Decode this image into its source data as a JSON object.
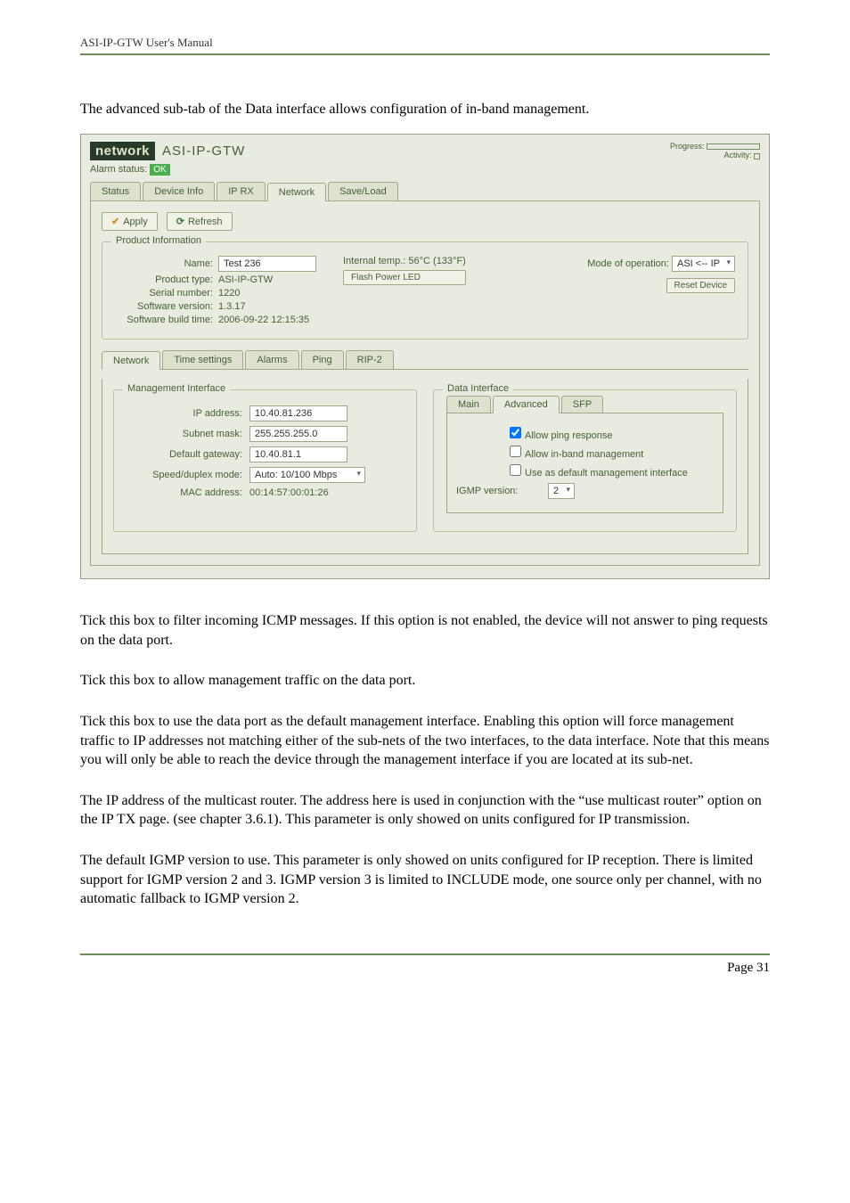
{
  "header": {
    "manual_title": "ASI-IP-GTW User's Manual"
  },
  "intro": "The advanced sub-tab of the Data interface allows configuration of in-band management.",
  "window": {
    "brand": "network",
    "model": "ASI-IP-GTW",
    "progress_label": "Progress:",
    "activity_label": "Activity:",
    "alarm_label": "Alarm status:",
    "alarm_value": "OK",
    "main_tabs": [
      "Status",
      "Device Info",
      "IP RX",
      "Network",
      "Save/Load"
    ],
    "active_main_tab": "Network",
    "apply_btn": "Apply",
    "refresh_btn": "Refresh",
    "product_info": {
      "legend": "Product Information",
      "name_label": "Name:",
      "name_value": "Test 236",
      "type_label": "Product type:",
      "type_value": "ASI-IP-GTW",
      "serial_label": "Serial number:",
      "serial_value": "1220",
      "sw_label": "Software version:",
      "sw_value": "1.3.17",
      "build_label": "Software build time:",
      "build_value": "2006-09-22 12:15:35",
      "temp_label": "Internal temp.:",
      "temp_value": "56°C (133°F)",
      "flash_btn": "Flash Power LED",
      "mode_label": "Mode of operation:",
      "mode_value": "ASI <-- IP",
      "reset_btn": "Reset Device"
    },
    "sub_tabs": [
      "Network",
      "Time settings",
      "Alarms",
      "Ping",
      "RIP-2"
    ],
    "active_sub_tab": "Network",
    "mgmt": {
      "legend": "Management Interface",
      "ip_label": "IP address:",
      "ip_value": "10.40.81.236",
      "mask_label": "Subnet mask:",
      "mask_value": "255.255.255.0",
      "gw_label": "Default gateway:",
      "gw_value": "10.40.81.1",
      "speed_label": "Speed/duplex mode:",
      "speed_value": "Auto: 10/100 Mbps",
      "mac_label": "MAC address:",
      "mac_value": "00:14:57:00:01:26"
    },
    "data_if": {
      "legend": "Data Interface",
      "tabs": [
        "Main",
        "Advanced",
        "SFP"
      ],
      "active_tab": "Advanced",
      "allow_ping": "Allow ping response",
      "allow_inband": "Allow in-band management",
      "use_default": "Use as default management interface",
      "igmp_label": "IGMP version:",
      "igmp_value": "2"
    }
  },
  "paragraphs": {
    "p1": "Tick this box to filter incoming ICMP messages. If this option is not enabled, the device will not answer to ping requests on the data port.",
    "p2": "Tick this box to allow management traffic on the data port.",
    "p3": "Tick this box to use the data port as the default management interface. Enabling this option will force management traffic to IP addresses not matching either of the sub-nets of the two interfaces, to the data interface. Note that this means you will only be able to reach the device through the management interface if you are located at its sub-net.",
    "p4": "The IP address of the multicast router. The address here is used in conjunction with the “use multicast router” option on the IP TX page. (see chapter 3.6.1). This parameter is only showed on units configured for IP transmission.",
    "p5": "The default IGMP version to use. This parameter is only showed on units configured for IP reception. There is limited support for IGMP version 2 and 3. IGMP version 3 is limited to INCLUDE mode, one source only per channel, with no automatic fallback to IGMP version 2."
  },
  "footer": {
    "page_label": "Page 31"
  }
}
